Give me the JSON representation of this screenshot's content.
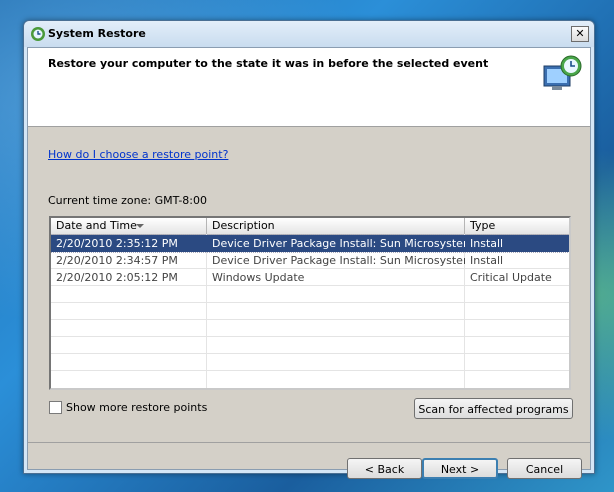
{
  "window": {
    "title": "System Restore"
  },
  "header": {
    "text": "Restore your computer to the state it was in before the selected event"
  },
  "help_link": "How do I choose a restore point?",
  "timezone_label": "Current time zone: GMT-8:00",
  "table": {
    "columns": [
      "Date and Time",
      "Description",
      "Type"
    ],
    "rows": [
      {
        "date": "2/20/2010 2:35:12 PM",
        "description": "Device Driver Package Install: Sun Microsystems,...",
        "type": "Install"
      },
      {
        "date": "2/20/2010 2:34:57 PM",
        "description": "Device Driver Package Install: Sun Microsystems,...",
        "type": "Install"
      },
      {
        "date": "2/20/2010 2:05:12 PM",
        "description": "Windows Update",
        "type": "Critical Update"
      }
    ],
    "selected_index": 0
  },
  "checkbox": {
    "label": "Show more restore points",
    "checked": false
  },
  "buttons": {
    "scan": "Scan for affected programs",
    "back": "< Back",
    "next": "Next >",
    "cancel": "Cancel"
  },
  "close_label": "✕",
  "colors": {
    "selection": "#2b4a82",
    "link": "#0033cc"
  }
}
